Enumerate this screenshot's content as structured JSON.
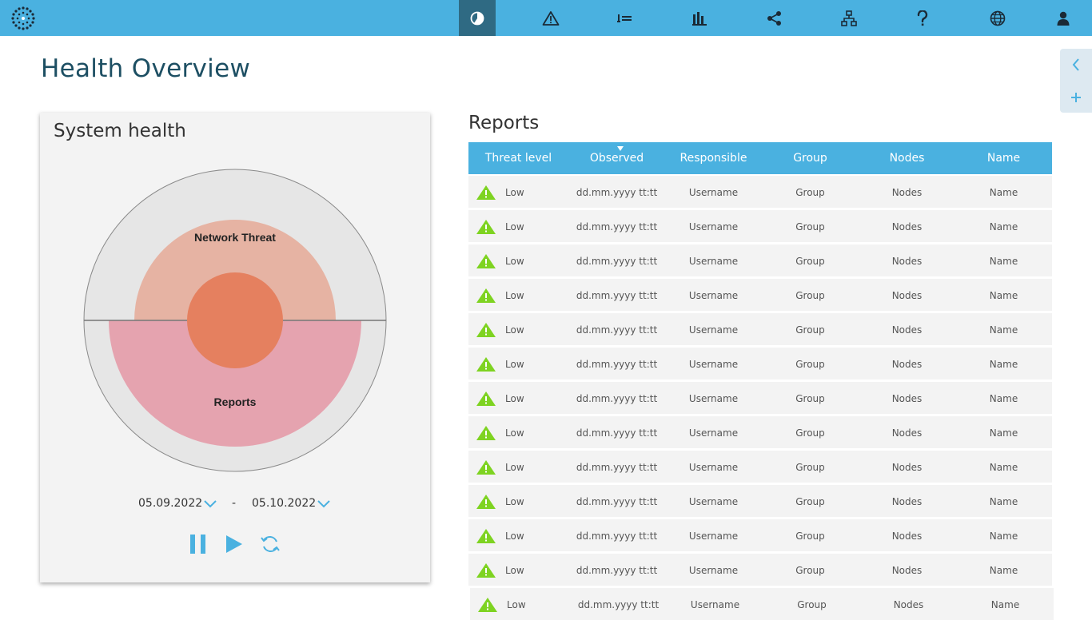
{
  "nav": {
    "items": [
      {
        "name": "dashboard-icon",
        "active": true
      },
      {
        "name": "warning-icon",
        "active": false
      },
      {
        "name": "list-icon",
        "active": false
      },
      {
        "name": "bar-chart-icon",
        "active": false
      },
      {
        "name": "share-icon",
        "active": false
      },
      {
        "name": "network-icon",
        "active": false
      },
      {
        "name": "help-icon",
        "active": false
      },
      {
        "name": "globe-icon",
        "active": false
      },
      {
        "name": "user-icon",
        "active": false
      }
    ],
    "accent": "#4ab1e0",
    "active_bg": "#2f6a83"
  },
  "page": {
    "title": "Health Overview"
  },
  "health": {
    "title": "System health",
    "network_label": "Network Threat",
    "reports_label": "Reports",
    "date_from": "05.09.2022",
    "date_sep": "-",
    "date_to": "05.10.2022",
    "colors": {
      "outer": "#e6e6e6",
      "network": "#e6b3a3",
      "reports": "#e5a3af",
      "core": "#e5805f"
    }
  },
  "reports": {
    "title": "Reports",
    "columns": [
      "Threat level",
      "Observed",
      "Responsible",
      "Group",
      "Nodes",
      "Name"
    ],
    "rows": [
      {
        "level": "Low",
        "observed": "dd.mm.yyyy tt:tt",
        "responsible": "Username",
        "group": "Group",
        "nodes": "Nodes",
        "name": "Name"
      },
      {
        "level": "Low",
        "observed": "dd.mm.yyyy tt:tt",
        "responsible": "Username",
        "group": "Group",
        "nodes": "Nodes",
        "name": "Name"
      },
      {
        "level": "Low",
        "observed": "dd.mm.yyyy tt:tt",
        "responsible": "Username",
        "group": "Group",
        "nodes": "Nodes",
        "name": "Name"
      },
      {
        "level": "Low",
        "observed": "dd.mm.yyyy tt:tt",
        "responsible": "Username",
        "group": "Group",
        "nodes": "Nodes",
        "name": "Name"
      },
      {
        "level": "Low",
        "observed": "dd.mm.yyyy tt:tt",
        "responsible": "Username",
        "group": "Group",
        "nodes": "Nodes",
        "name": "Name"
      },
      {
        "level": "Low",
        "observed": "dd.mm.yyyy tt:tt",
        "responsible": "Username",
        "group": "Group",
        "nodes": "Nodes",
        "name": "Name"
      },
      {
        "level": "Low",
        "observed": "dd.mm.yyyy tt:tt",
        "responsible": "Username",
        "group": "Group",
        "nodes": "Nodes",
        "name": "Name"
      },
      {
        "level": "Low",
        "observed": "dd.mm.yyyy tt:tt",
        "responsible": "Username",
        "group": "Group",
        "nodes": "Nodes",
        "name": "Name"
      },
      {
        "level": "Low",
        "observed": "dd.mm.yyyy tt:tt",
        "responsible": "Username",
        "group": "Group",
        "nodes": "Nodes",
        "name": "Name"
      },
      {
        "level": "Low",
        "observed": "dd.mm.yyyy tt:tt",
        "responsible": "Username",
        "group": "Group",
        "nodes": "Nodes",
        "name": "Name"
      },
      {
        "level": "Low",
        "observed": "dd.mm.yyyy tt:tt",
        "responsible": "Username",
        "group": "Group",
        "nodes": "Nodes",
        "name": "Name"
      },
      {
        "level": "Low",
        "observed": "dd.mm.yyyy tt:tt",
        "responsible": "Username",
        "group": "Group",
        "nodes": "Nodes",
        "name": "Name"
      },
      {
        "level": "Low",
        "observed": "dd.mm.yyyy tt:tt",
        "responsible": "Username",
        "group": "Group",
        "nodes": "Nodes",
        "name": "Name"
      }
    ],
    "warn_color": "#7ed321"
  }
}
